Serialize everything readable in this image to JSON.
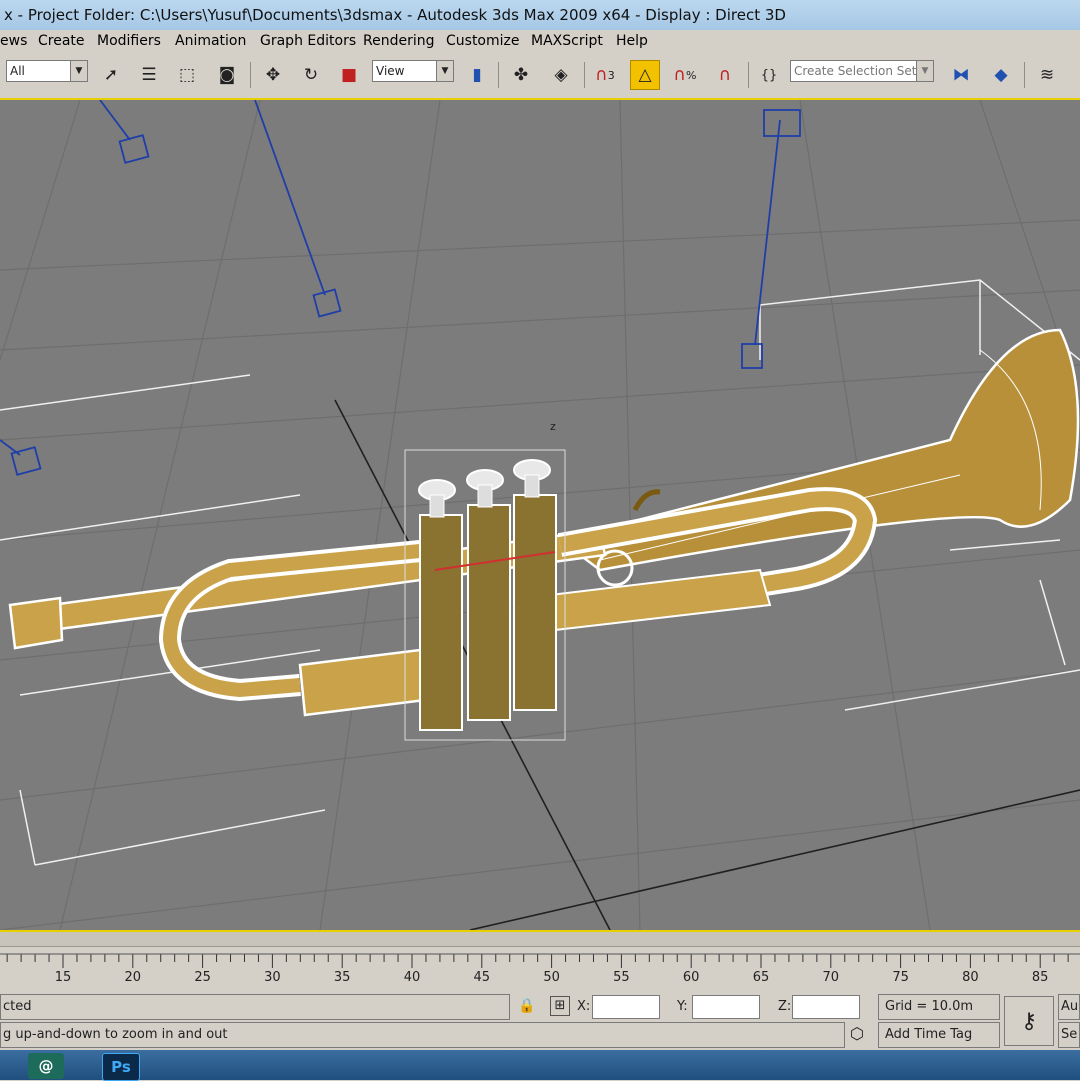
{
  "window": {
    "title": "x    - Project Folder: C:\\Users\\Yusuf\\Documents\\3dsmax    - Autodesk 3ds Max  2009 x64     - Display : Direct 3D"
  },
  "menu": [
    "ews",
    "Create",
    "Modifiers",
    "Animation",
    "Graph Editors",
    "Rendering",
    "Customize",
    "MAXScript",
    "Help"
  ],
  "toolbar": {
    "filter_value": "All",
    "view_value": "View",
    "selection_set_placeholder": "Create Selection Set",
    "snap_label": "3",
    "percent_snap_label": "%"
  },
  "viewport": {
    "axis_label": "z"
  },
  "timeline": {
    "ticks": [
      "15",
      "20",
      "25",
      "30",
      "35",
      "40",
      "45",
      "50",
      "55",
      "60",
      "65",
      "70",
      "75",
      "80",
      "85"
    ]
  },
  "status": {
    "selected_text": "cted",
    "prompt_text": "g up-and-down to zoom in and out",
    "x_label": "X:",
    "y_label": "Y:",
    "z_label": "Z:",
    "grid_text": "Grid = 10.0m",
    "time_tag": "Add Time Tag",
    "auto_text": "Au",
    "set_text": "Se"
  },
  "taskbar": {
    "ps_label": "Ps"
  },
  "colors": {
    "viewport_bg": "#7c7c7c",
    "active_border": "#e8d000",
    "wireframe": "#ffffff",
    "brass": "#c9a24a",
    "lights": "#1f3ea8"
  }
}
